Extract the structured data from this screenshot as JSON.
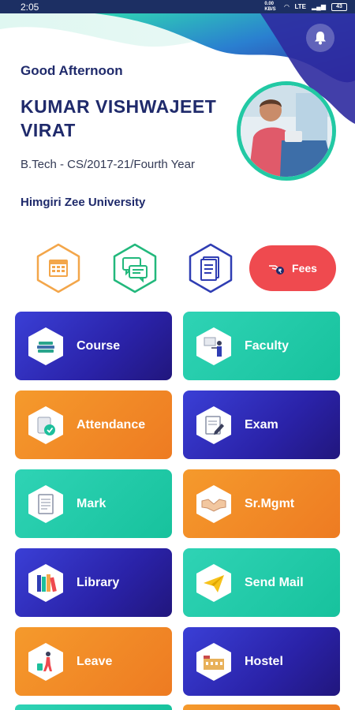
{
  "status": {
    "time": "2:05",
    "net_speed": "0.00 KB/S",
    "network": "LTE",
    "battery": "43"
  },
  "header": {
    "greeting": "Good Afternoon",
    "student_name": "KUMAR VISHWAJEET VIRAT",
    "course_info": "B.Tech - CS/2017-21/Fourth Year",
    "university": "Himgiri Zee University"
  },
  "quick_actions": [
    {
      "name": "calendar-icon",
      "color": "#f3a64a"
    },
    {
      "name": "chat-icon",
      "color": "#22b87c"
    },
    {
      "name": "document-icon",
      "color": "#2f3db3"
    }
  ],
  "fees": {
    "label": "Fees",
    "color": "#ef4a4f"
  },
  "tiles": [
    {
      "label": "Course",
      "icon": "book-stack-icon",
      "style": "blue"
    },
    {
      "label": "Faculty",
      "icon": "teacher-icon",
      "style": "green"
    },
    {
      "label": "Attendance",
      "icon": "attendance-icon",
      "style": "orange"
    },
    {
      "label": "Exam",
      "icon": "exam-icon",
      "style": "blue"
    },
    {
      "label": "Mark",
      "icon": "marksheet-icon",
      "style": "green"
    },
    {
      "label": "Sr.Mgmt",
      "icon": "handshake-icon",
      "style": "orange"
    },
    {
      "label": "Library",
      "icon": "library-books-icon",
      "style": "blue"
    },
    {
      "label": "Send Mail",
      "icon": "paper-plane-icon",
      "style": "green"
    },
    {
      "label": "Leave",
      "icon": "traveller-icon",
      "style": "orange"
    },
    {
      "label": "Hostel",
      "icon": "building-icon",
      "style": "blue"
    }
  ]
}
